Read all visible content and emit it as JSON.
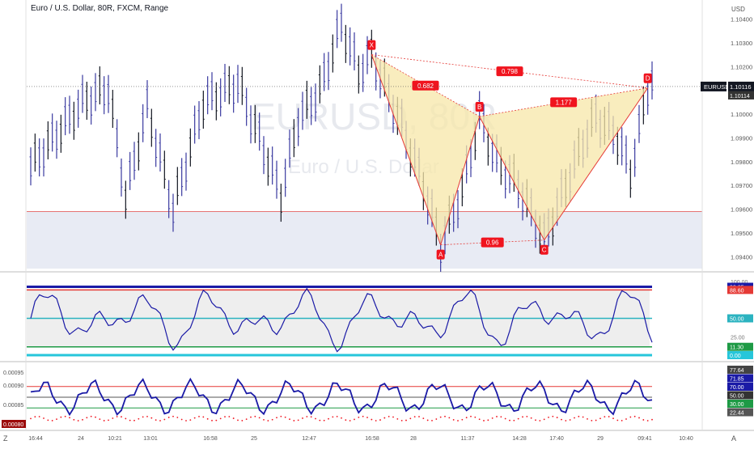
{
  "chart_data": {
    "type": "candlestick",
    "title": "Euro / U.S. Dollar, 80R, FXCM, Range",
    "watermark": {
      "symbol": "EURUSD, 80R",
      "name": "Euro / U.S. Dollar"
    },
    "currency": "USD",
    "symbol_label": "EURUSD",
    "last_price": "1.10116",
    "prev_price": "1.10114",
    "price_axis": {
      "min": 1.0935,
      "max": 1.1048,
      "ticks": [
        "1.10400",
        "1.10300",
        "1.10200",
        "1.10000",
        "1.09900",
        "1.09800",
        "1.09700",
        "1.09600",
        "1.09500",
        "1.09400"
      ]
    },
    "time_axis": [
      "16:44",
      "24",
      "10:21",
      "13:01",
      "16:58",
      "25",
      "12:47",
      "16:58",
      "28",
      "11:37",
      "14:28",
      "17:40",
      "29",
      "09:41",
      "10:40"
    ],
    "pattern": {
      "points": [
        {
          "label": "X",
          "bar": 79,
          "price": 1.1025
        },
        {
          "label": "A",
          "bar": 95,
          "price": 1.0945
        },
        {
          "label": "B",
          "bar": 104,
          "price": 1.0999
        },
        {
          "label": "C",
          "bar": 119,
          "price": 1.0947
        },
        {
          "label": "D",
          "bar": 143,
          "price": 1.1011
        }
      ],
      "ratios": [
        "0.682",
        "0.96",
        "1.177",
        "0.798"
      ],
      "support_line": 1.0959,
      "colors": {
        "fill": "#f7e7a8",
        "line": "#e53935",
        "label": "#f0141e"
      }
    },
    "bars": 145,
    "indicator1": {
      "range": [
        0,
        100
      ],
      "levels": [
        {
          "value": 92.85,
          "label": "92.85",
          "color": "#1a1aa6"
        },
        {
          "value": 88.6,
          "label": "88.60",
          "color": "#e53935"
        },
        {
          "value": 50,
          "label": "50.00",
          "color": "#2bb3c0"
        },
        {
          "value": 11.3,
          "label": "11.30",
          "color": "#1e9a45"
        },
        {
          "value": 0,
          "label": "0.00",
          "color": "#26c6da"
        }
      ],
      "extra_labels": [
        "100.00",
        "25.00"
      ]
    },
    "indicator2": {
      "left_labels": [
        "0.00095",
        "0.00090",
        "0.00085",
        "0.00080"
      ],
      "right_labels": [
        {
          "label": "77.64",
          "color": "#444"
        },
        {
          "label": "71.85",
          "color": "#1a1aa6"
        },
        {
          "label": "70.00",
          "color": "#1a1aa6"
        },
        {
          "label": "50.00",
          "color": "#333"
        },
        {
          "label": "30.00",
          "color": "#1e9a45"
        },
        {
          "label": "22.44",
          "color": "#555"
        }
      ],
      "lines": {
        "upper": 70,
        "middle": 50,
        "lower": 30
      }
    },
    "colors": {
      "candle": "#3a3aa0",
      "accent": "#0f0f9c",
      "highlight": "#f0141e"
    }
  },
  "ui": {
    "corner_left": "Z",
    "corner_right": "A"
  }
}
